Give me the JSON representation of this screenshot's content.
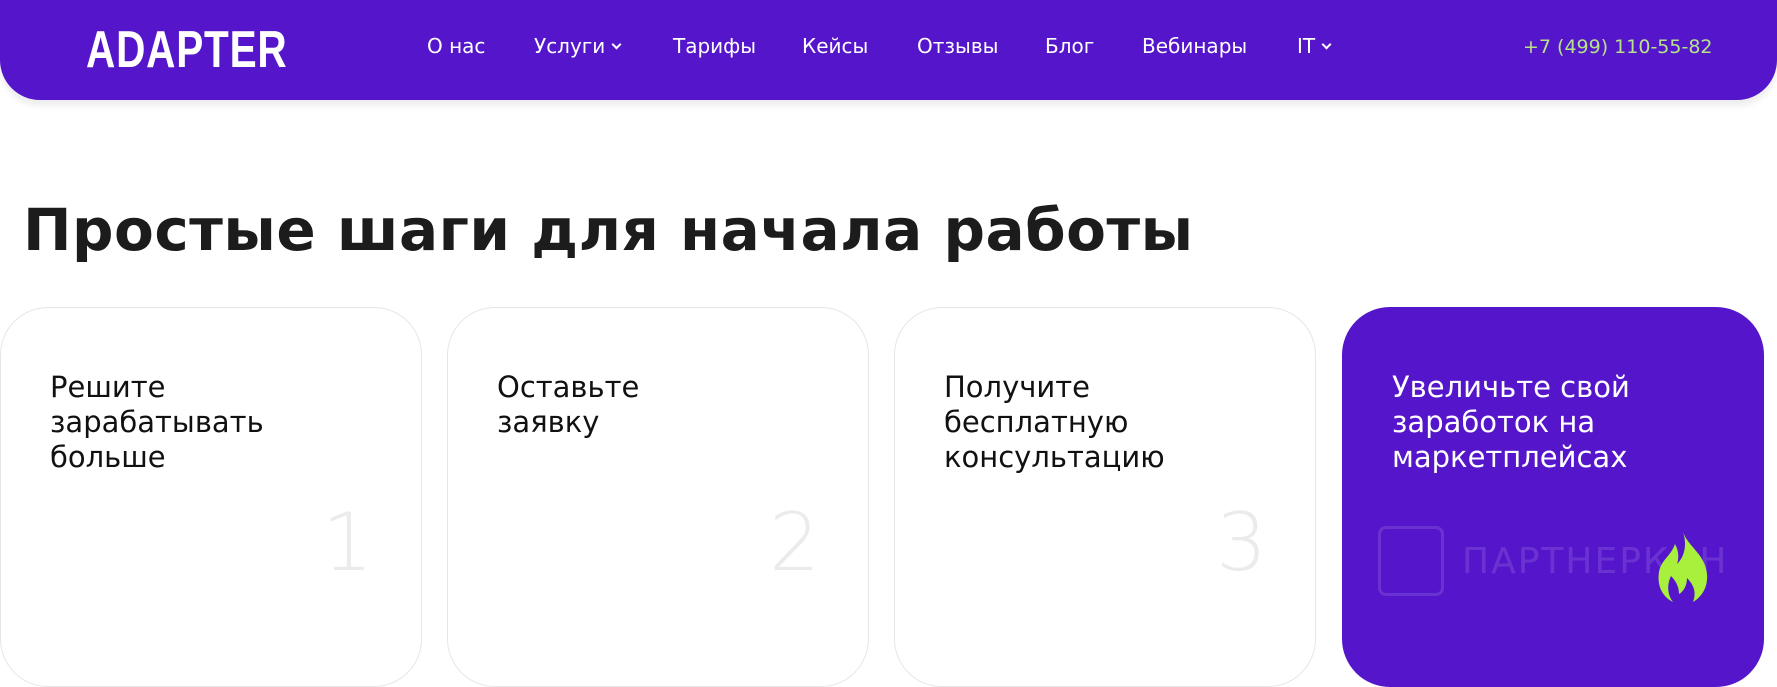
{
  "header": {
    "logo": "ADAPTER",
    "nav": [
      {
        "label": "О нас",
        "dropdown": false
      },
      {
        "label": "Услуги",
        "dropdown": true
      },
      {
        "label": "Тарифы",
        "dropdown": false
      },
      {
        "label": "Кейсы",
        "dropdown": false
      },
      {
        "label": "Отзывы",
        "dropdown": false
      },
      {
        "label": "Блог",
        "dropdown": false
      },
      {
        "label": "Вебинары",
        "dropdown": false
      },
      {
        "label": "IT",
        "dropdown": true
      }
    ],
    "phone": "+7 (499) 110-55-82"
  },
  "section": {
    "title": "Простые шаги для начала работы",
    "cards": [
      {
        "text": "Решите зарабатывать больше",
        "number": "1"
      },
      {
        "text": "Оставьте заявку",
        "number": "2"
      },
      {
        "text": "Получите бесплатную консультацию",
        "number": "3"
      },
      {
        "text": "Увеличьте свой заработок на маркетплейсах",
        "icon": "flame-icon"
      }
    ]
  },
  "watermark": "ПАРТНЕРКИН",
  "colors": {
    "brand": "#5516cb",
    "phone": "#b6e38a",
    "flame": "#a8f03c"
  }
}
